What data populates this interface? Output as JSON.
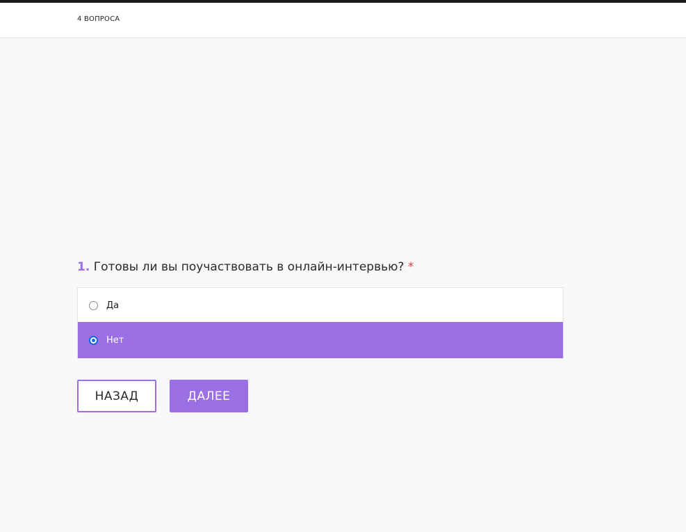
{
  "header": {
    "question_count": "4 ВОПРОСА"
  },
  "question": {
    "number": "1.",
    "text": "Готовы ли вы поучаствовать в онлайн-интервью?",
    "required_mark": "*",
    "options": [
      {
        "label": "Да",
        "selected": false
      },
      {
        "label": "Нет",
        "selected": true
      }
    ]
  },
  "buttons": {
    "back_label": "НАЗАД",
    "next_label": "ДАЛЕЕ"
  },
  "colors": {
    "accent": "#9b6fe4",
    "required": "#e0413b",
    "radio_checked": "#1468e0"
  }
}
